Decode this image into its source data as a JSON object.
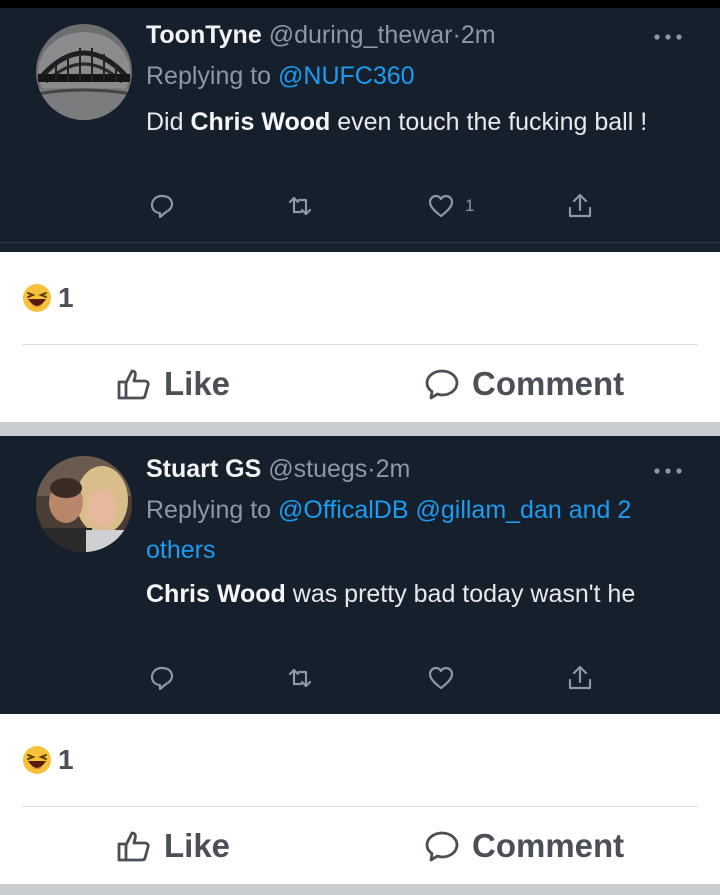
{
  "tweets": [
    {
      "name": "ToonTyne",
      "handle": "@during_thewar",
      "dot": "·",
      "time": "2m",
      "replying_prefix": "Replying to",
      "replying_to": "@NUFC360",
      "body_bold": "Chris Wood",
      "body_rest": "even touch the fucking ball !",
      "body_prefix": "Did",
      "likes": "1",
      "avatar_icon": "bridge-avatar-icon"
    },
    {
      "name": "Stuart GS",
      "handle": "@stuegs",
      "dot": "·",
      "time": "2m",
      "replying_prefix": "Replying to",
      "replying_to": "@OfficalDB @gillam_dan and 2 others",
      "body_bold": "Chris Wood",
      "body_rest": "was pretty bad today wasn't he",
      "likes": "",
      "avatar_icon": "couple-photo-avatar-icon"
    }
  ],
  "reactions": [
    {
      "count": "1",
      "icon": "laughing-emoji-icon"
    },
    {
      "count": "1",
      "icon": "laughing-emoji-icon"
    }
  ],
  "fb_actions": {
    "like_label": "Like",
    "comment_label": "Comment"
  },
  "colors": {
    "tweet_bg": "#16202d",
    "link": "#1d9bf0",
    "muted": "#8b98a5",
    "fb_text": "#4b4f56"
  }
}
